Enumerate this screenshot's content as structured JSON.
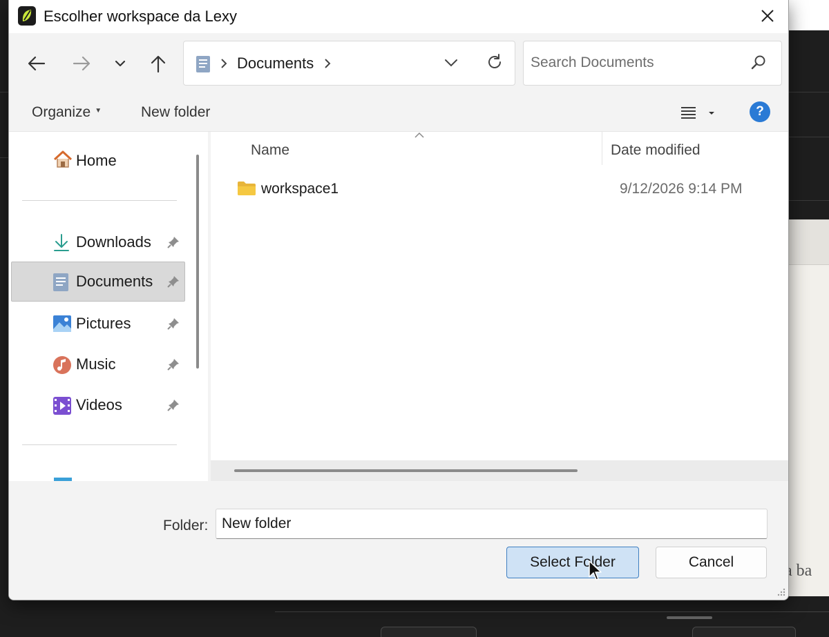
{
  "dialog": {
    "title": "Escolher workspace da Lexy",
    "app_icon": "lexy-leaf-icon",
    "close_icon": "close-icon"
  },
  "navigation": {
    "back_icon": "arrow-left-icon",
    "forward_icon": "arrow-right-icon",
    "recent_icon": "chevron-down-icon",
    "up_icon": "arrow-up-icon"
  },
  "address_bar": {
    "location_icon": "documents-icon",
    "crumbs": [
      "Documents"
    ],
    "dropdown_icon": "chevron-down-icon",
    "refresh_icon": "refresh-icon"
  },
  "search": {
    "placeholder": "Search Documents",
    "value": "",
    "icon": "search-icon"
  },
  "command_bar": {
    "organize_label": "Organize",
    "new_folder_label": "New folder",
    "view_icon": "view-options-icon",
    "help_label": "?"
  },
  "sidebar": {
    "home": {
      "label": "Home",
      "icon": "home-icon"
    },
    "items": [
      {
        "label": "Downloads",
        "icon": "download-icon",
        "pinned": true,
        "selected": false
      },
      {
        "label": "Documents",
        "icon": "documents-icon",
        "pinned": true,
        "selected": true
      },
      {
        "label": "Pictures",
        "icon": "pictures-icon",
        "pinned": true,
        "selected": false
      },
      {
        "label": "Music",
        "icon": "music-icon",
        "pinned": true,
        "selected": false
      },
      {
        "label": "Videos",
        "icon": "videos-icon",
        "pinned": true,
        "selected": false
      }
    ]
  },
  "file_list": {
    "columns": [
      "Name",
      "Date modified"
    ],
    "sort_column": "Name",
    "rows": [
      {
        "name": "workspace1",
        "date_modified": "9/12/2026 9:14 PM",
        "type": "folder"
      }
    ]
  },
  "footer": {
    "folder_label": "Folder:",
    "folder_value": "New folder",
    "select_button": "Select Folder",
    "cancel_button": "Cancel"
  },
  "background": {
    "visible_text": "r a ba"
  },
  "colors": {
    "accent": "#2a7ad5",
    "primary_button_bg": "#cfe2f5",
    "primary_button_border": "#3f7fc1",
    "selection": "#d9d9d9",
    "folder_yellow": "#f5c842"
  }
}
